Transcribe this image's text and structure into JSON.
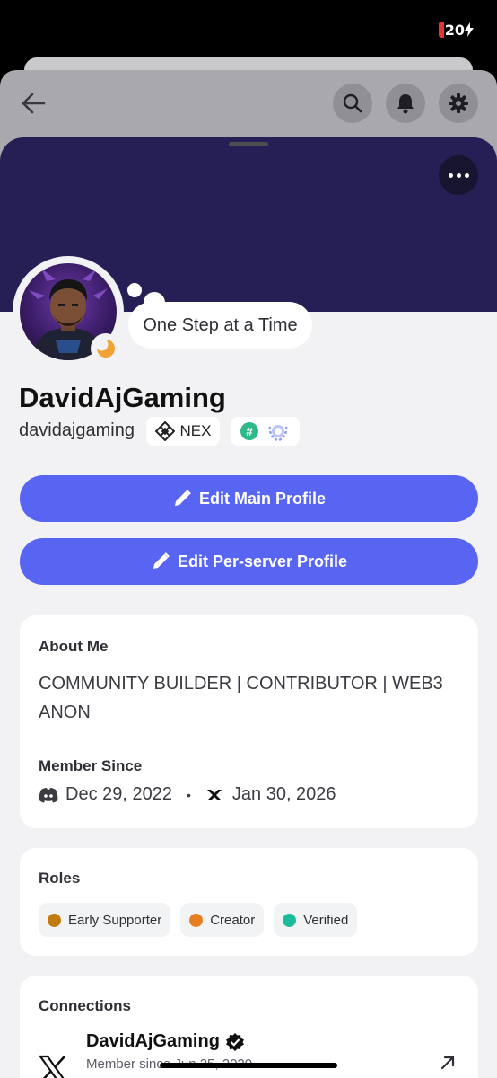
{
  "status_bar": {
    "battery": "20"
  },
  "profile": {
    "custom_status": "One Step at a Time",
    "display_name": "DavidAjGaming",
    "username": "davidajgaming",
    "server_tag": "NEX"
  },
  "buttons": {
    "edit_main": "Edit Main Profile",
    "edit_per_server": "Edit Per-server Profile"
  },
  "about": {
    "title": "About Me",
    "bio": "COMMUNITY BUILDER | CONTRIBUTOR | WEB3 ANON",
    "member_since_title": "Member Since",
    "discord_date": "Dec 29, 2022",
    "server_date": "Jan 30, 2026"
  },
  "roles": {
    "title": "Roles",
    "items": [
      {
        "label": "Early Supporter",
        "color": "#c27c0e"
      },
      {
        "label": "Creator",
        "color": "#e67e22"
      },
      {
        "label": "Verified",
        "color": "#1abc9c"
      }
    ]
  },
  "connections": {
    "title": "Connections",
    "items": [
      {
        "name": "DavidAjGaming",
        "sub": "Member since Jun 25, 2020",
        "service_icon": "x-icon"
      }
    ]
  },
  "colors": {
    "banner": "#261f56",
    "accent": "#5865f2"
  }
}
